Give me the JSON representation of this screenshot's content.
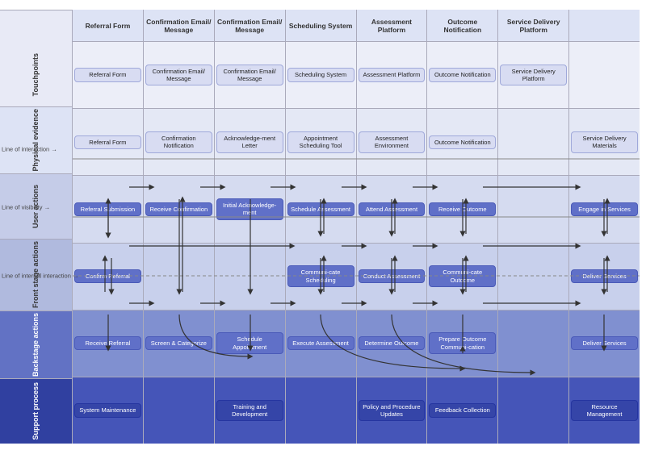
{
  "header_row": {
    "cols": [
      "Referral Form",
      "Confirmation Email/ Message",
      "Confirmation Email/ Message",
      "Scheduling System",
      "Assessment Platform",
      "Outcome Notification",
      "Service Delivery Platform"
    ]
  },
  "rows": [
    {
      "id": "touchpoints",
      "label": "Touchpoints",
      "bg_class": "bg-touchpoints",
      "lbl_class": "lbl-touchpoints",
      "card_class": "card-pale",
      "cells": [
        "Referral Form",
        "Confirmation Email/ Message",
        "Confirmation Email/ Message",
        "Scheduling System",
        "Assessment Platform",
        "Outcome Notification",
        "Service Delivery Platform",
        ""
      ]
    },
    {
      "id": "physical",
      "label": "Physical evidence",
      "bg_class": "bg-physical",
      "lbl_class": "lbl-physical",
      "card_class": "card-pale",
      "cells": [
        "Referral Form",
        "Confirmation Notification",
        "Acknowledge-ment Letter",
        "Appointment Scheduling Tool",
        "Assessment Environment",
        "Outcome Notification",
        "",
        "Service Delivery Materials"
      ]
    },
    {
      "id": "user",
      "label": "User actions",
      "bg_class": "bg-user",
      "lbl_class": "lbl-user",
      "card_class": "card-blue",
      "cells": [
        "Referral Submission",
        "Receive Confirmation",
        "Initial Acknowledge-ment",
        "Schedule Assessment",
        "Attend Assessment",
        "Receive Outcome",
        "",
        "Engage in Services"
      ]
    },
    {
      "id": "front",
      "label": "Front stage actions",
      "bg_class": "bg-front",
      "lbl_class": "lbl-front",
      "card_class": "card-blue",
      "cells": [
        "Confirm Referral",
        "",
        "",
        "Communi-cate Scheduling",
        "Conduct Assessment",
        "Communi-cate Outcome",
        "",
        "Deliver Services"
      ]
    },
    {
      "id": "back",
      "label": "Backstage actions",
      "bg_class": "bg-back",
      "lbl_class": "lbl-back",
      "card_class": "card-blue",
      "cells": [
        "Receive Referral",
        "Screen & Categorize",
        "Schedule Appointment",
        "Execute Assessment",
        "Determine Outcome",
        "Prepare Outcome Communi-cation",
        "",
        "Deliver Services"
      ]
    },
    {
      "id": "support",
      "label": "Support process",
      "bg_class": "bg-support",
      "lbl_class": "lbl-support",
      "card_class": "card-darkblue",
      "cells": [
        "System Maintenance",
        "",
        "Training and Development",
        "",
        "Policy and Procedure Updates",
        "Feedback Collection",
        "",
        "Resource Management"
      ]
    }
  ],
  "line_labels": {
    "line_of_interaction": "Line of interaction",
    "line_of_visibility": "Line of visibility",
    "line_of_internal": "Line of internal interaction"
  }
}
